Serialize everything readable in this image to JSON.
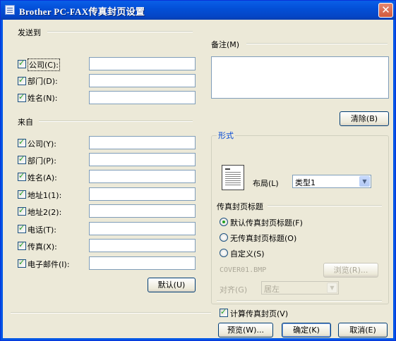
{
  "window": {
    "title": "Brother PC-FAX传真封页设置"
  },
  "to_section": {
    "label": "发送到",
    "fields": [
      {
        "label": "公司(C):",
        "checked": true,
        "value": ""
      },
      {
        "label": "部门(D):",
        "checked": true,
        "value": ""
      },
      {
        "label": "姓名(N):",
        "checked": true,
        "value": ""
      }
    ]
  },
  "from_section": {
    "label": "来自",
    "fields": [
      {
        "label": "公司(Y):",
        "checked": true,
        "value": ""
      },
      {
        "label": "部门(P):",
        "checked": true,
        "value": ""
      },
      {
        "label": "姓名(A):",
        "checked": true,
        "value": ""
      },
      {
        "label": "地址1(1):",
        "checked": true,
        "value": ""
      },
      {
        "label": "地址2(2):",
        "checked": true,
        "value": ""
      },
      {
        "label": "电话(T):",
        "checked": true,
        "value": ""
      },
      {
        "label": "传真(X):",
        "checked": true,
        "value": ""
      },
      {
        "label": "电子邮件(I):",
        "checked": true,
        "value": ""
      }
    ],
    "default_button": "默认(U)"
  },
  "comment_section": {
    "label": "备注(M)",
    "value": "",
    "clear_button": "清除(B)"
  },
  "form_section": {
    "label": "形式",
    "layout_label": "布局(L)",
    "layout_value": "类型1",
    "header_label": "传真封页标题",
    "radio_options": [
      {
        "label": "默认传真封页标题(F)",
        "checked": true
      },
      {
        "label": "无传真封页标题(O)",
        "checked": false
      },
      {
        "label": "自定义(S)",
        "checked": false
      }
    ],
    "custom_file": "COVER01.BMP",
    "browse_button": "浏览(R)...",
    "align_label": "对齐(G)",
    "align_value": "居左",
    "count_label": "计算传真封页(V)",
    "count_checked": true
  },
  "footer": {
    "preview_button": "预览(W)...",
    "ok_button": "确定(K)",
    "cancel_button": "取消(E)"
  }
}
